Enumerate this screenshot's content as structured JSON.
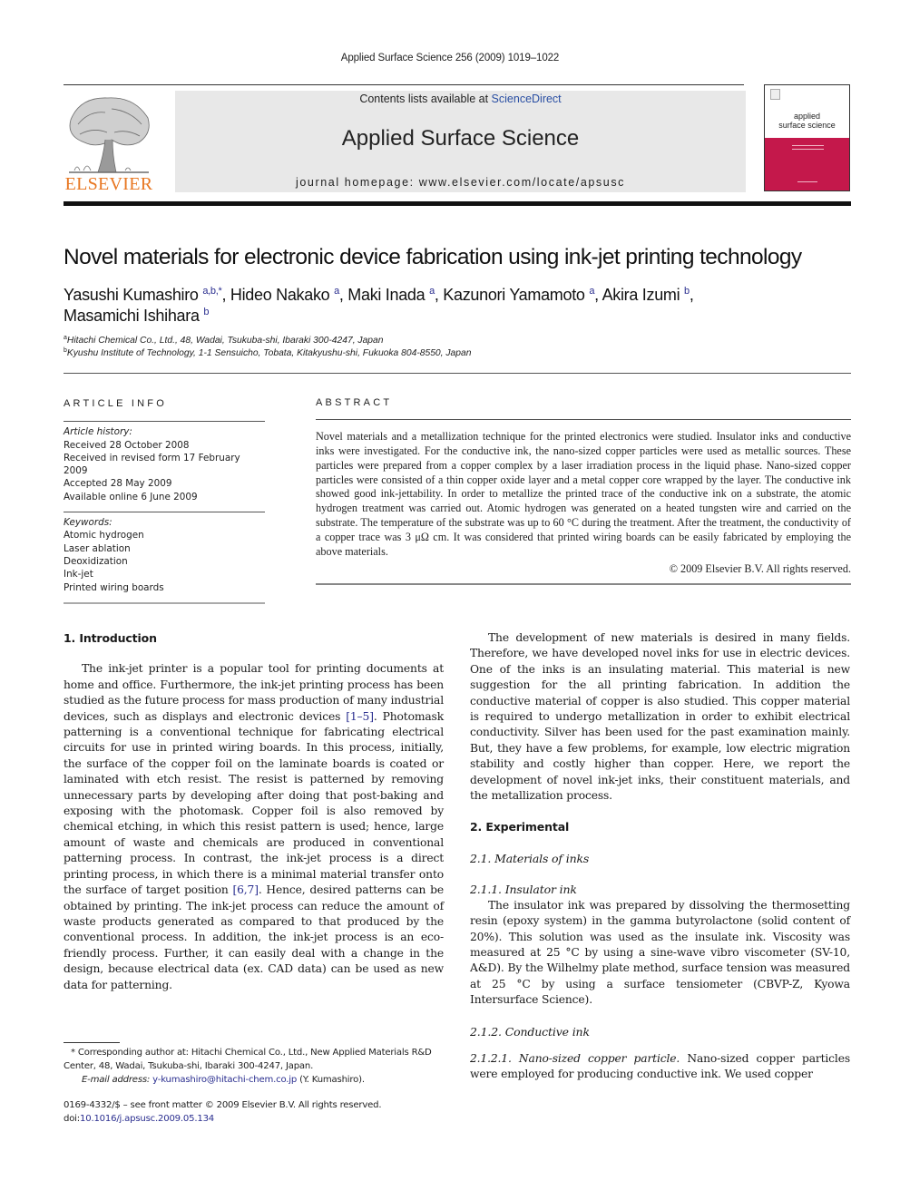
{
  "header": {
    "citation": "Applied Surface Science 256 (2009) 1019–1022",
    "contents_prefix": "Contents lists available at ",
    "contents_link": "ScienceDirect",
    "journal_name": "Applied Surface Science",
    "homepage": "journal homepage: www.elsevier.com/locate/apsusc",
    "publisher_logo_text": "ELSEVIER",
    "cover_title_line1": "applied",
    "cover_title_line2": "surface science",
    "colors": {
      "publisher_orange": "#e87722",
      "link_blue": "#2a4fa3",
      "cover_red": "#c4184b",
      "masthead_gray": "#e8e8e8"
    }
  },
  "article": {
    "title": "Novel materials for electronic device fabrication using ink-jet printing technology",
    "authors": [
      {
        "name": "Yasushi Kumashiro",
        "marks": "a,b,*"
      },
      {
        "name": "Hideo Nakako",
        "marks": "a"
      },
      {
        "name": "Maki Inada",
        "marks": "a"
      },
      {
        "name": "Kazunori Yamamoto",
        "marks": "a"
      },
      {
        "name": "Akira Izumi",
        "marks": "b"
      },
      {
        "name": "Masamichi Ishihara",
        "marks": "b"
      }
    ],
    "affiliations": [
      {
        "mark": "a",
        "text": "Hitachi Chemical Co., Ltd., 48, Wadai, Tsukuba-shi, Ibaraki 300-4247, Japan"
      },
      {
        "mark": "b",
        "text": "Kyushu Institute of Technology, 1-1 Sensuicho, Tobata, Kitakyushu-shi, Fukuoka 804-8550, Japan"
      }
    ]
  },
  "article_info": {
    "label": "ARTICLE INFO",
    "history_label": "Article history:",
    "history": [
      "Received 28 October 2008",
      "Received in revised form 17 February 2009",
      "Accepted 28 May 2009",
      "Available online 6 June 2009"
    ],
    "keywords_label": "Keywords:",
    "keywords": [
      "Atomic hydrogen",
      "Laser ablation",
      "Deoxidization",
      "Ink-jet",
      "Printed wiring boards"
    ]
  },
  "abstract": {
    "label": "ABSTRACT",
    "text": "Novel materials and a metallization technique for the printed electronics were studied. Insulator inks and conductive inks were investigated. For the conductive ink, the nano-sized copper particles were used as metallic sources. These particles were prepared from a copper complex by a laser irradiation process in the liquid phase. Nano-sized copper particles were consisted of a thin copper oxide layer and a metal copper core wrapped by the layer. The conductive ink showed good ink-jettability. In order to metallize the printed trace of the conductive ink on a substrate, the atomic hydrogen treatment was carried out. Atomic hydrogen was generated on a heated tungsten wire and carried on the substrate. The temperature of the substrate was up to 60 °C during the treatment. After the treatment, the conductivity of a copper trace was 3 μΩ cm. It was considered that printed wiring boards can be easily fabricated by employing the above materials.",
    "copyright": "© 2009 Elsevier B.V. All rights reserved."
  },
  "body": {
    "intro_heading": "1.  Introduction",
    "intro_p1_a": "The ink-jet printer is a popular tool for printing documents at home and office. Furthermore, the ink-jet printing process has been studied as the future process for mass production of many industrial devices, such as displays and electronic devices ",
    "intro_ref1": "[1–5]",
    "intro_p1_b": ". Photomask patterning is a conventional technique for fabricating electrical circuits for use in printed wiring boards. In this process, initially, the surface of the copper foil on the laminate boards is coated or laminated with etch resist. The resist is patterned by removing unnecessary parts by developing after doing that post-baking and exposing with the photomask. Copper foil is also removed by chemical etching, in which this resist pattern is used; hence, large amount of waste and chemicals are produced in conventional patterning process. In contrast, the ink-jet process is a direct printing process, in which there is a minimal material transfer onto the surface of target position ",
    "intro_ref2": "[6,7]",
    "intro_p1_c": ". Hence, desired patterns can be obtained by printing. The ink-jet process can reduce the amount of waste products generated as compared to that produced by the conventional process. In addition, the ink-jet process is an eco-friendly process. Further, it can easily deal with a change in the design, because electrical data (ex. CAD data) can be used as new data for patterning.",
    "intro_p2": "The development of new materials is desired in many fields. Therefore, we have developed novel inks for use in electric devices. One of the inks is an insulating material. This material is new suggestion for the all printing fabrication. In addition the conductive material of copper is also studied. This copper material is required to undergo metallization in order to exhibit electrical conductivity. Silver has been used for the past examination mainly. But, they have a few problems, for example, low electric migration stability and costly higher than copper. Here, we report the development of novel ink-jet inks, their constituent materials, and the metallization process.",
    "exp_heading": "2.  Experimental",
    "sub_2_1": "2.1.  Materials of inks",
    "sub_2_1_1": "2.1.1.  Insulator ink",
    "insulator_p": "The insulator ink was prepared by dissolving the thermosetting resin (epoxy system) in the gamma butyrolactone (solid content of 20%). This solution was used as the insulate ink. Viscosity was measured at 25 °C by using a sine-wave vibro viscometer (SV-10, A&D). By the Wilhelmy plate method, surface tension was measured at 25 °C by using a surface tensiometer (CBVP-Z, Kyowa Intersurface Science).",
    "sub_2_1_2": "2.1.2.  Conductive ink",
    "sub_2_1_2_1": "2.1.2.1.  Nano-sized copper particle.",
    "nano_p": " Nano-sized copper particles were employed for producing conductive ink. We used copper"
  },
  "footnotes": {
    "corresponding_mark": "*",
    "corresponding": "Corresponding author at: Hitachi Chemical Co., Ltd., New Applied Materials R&D Center, 48, Wadai, Tsukuba-shi, Ibaraki 300-4247, Japan.",
    "email_label": "E-mail address:",
    "email": "y-kumashiro@hitachi-chem.co.jp",
    "email_suffix": " (Y. Kumashiro).",
    "front_matter": "0169-4332/$ – see front matter © 2009 Elsevier B.V. All rights reserved.",
    "doi_prefix": "doi:",
    "doi": "10.1016/j.apsusc.2009.05.134"
  }
}
